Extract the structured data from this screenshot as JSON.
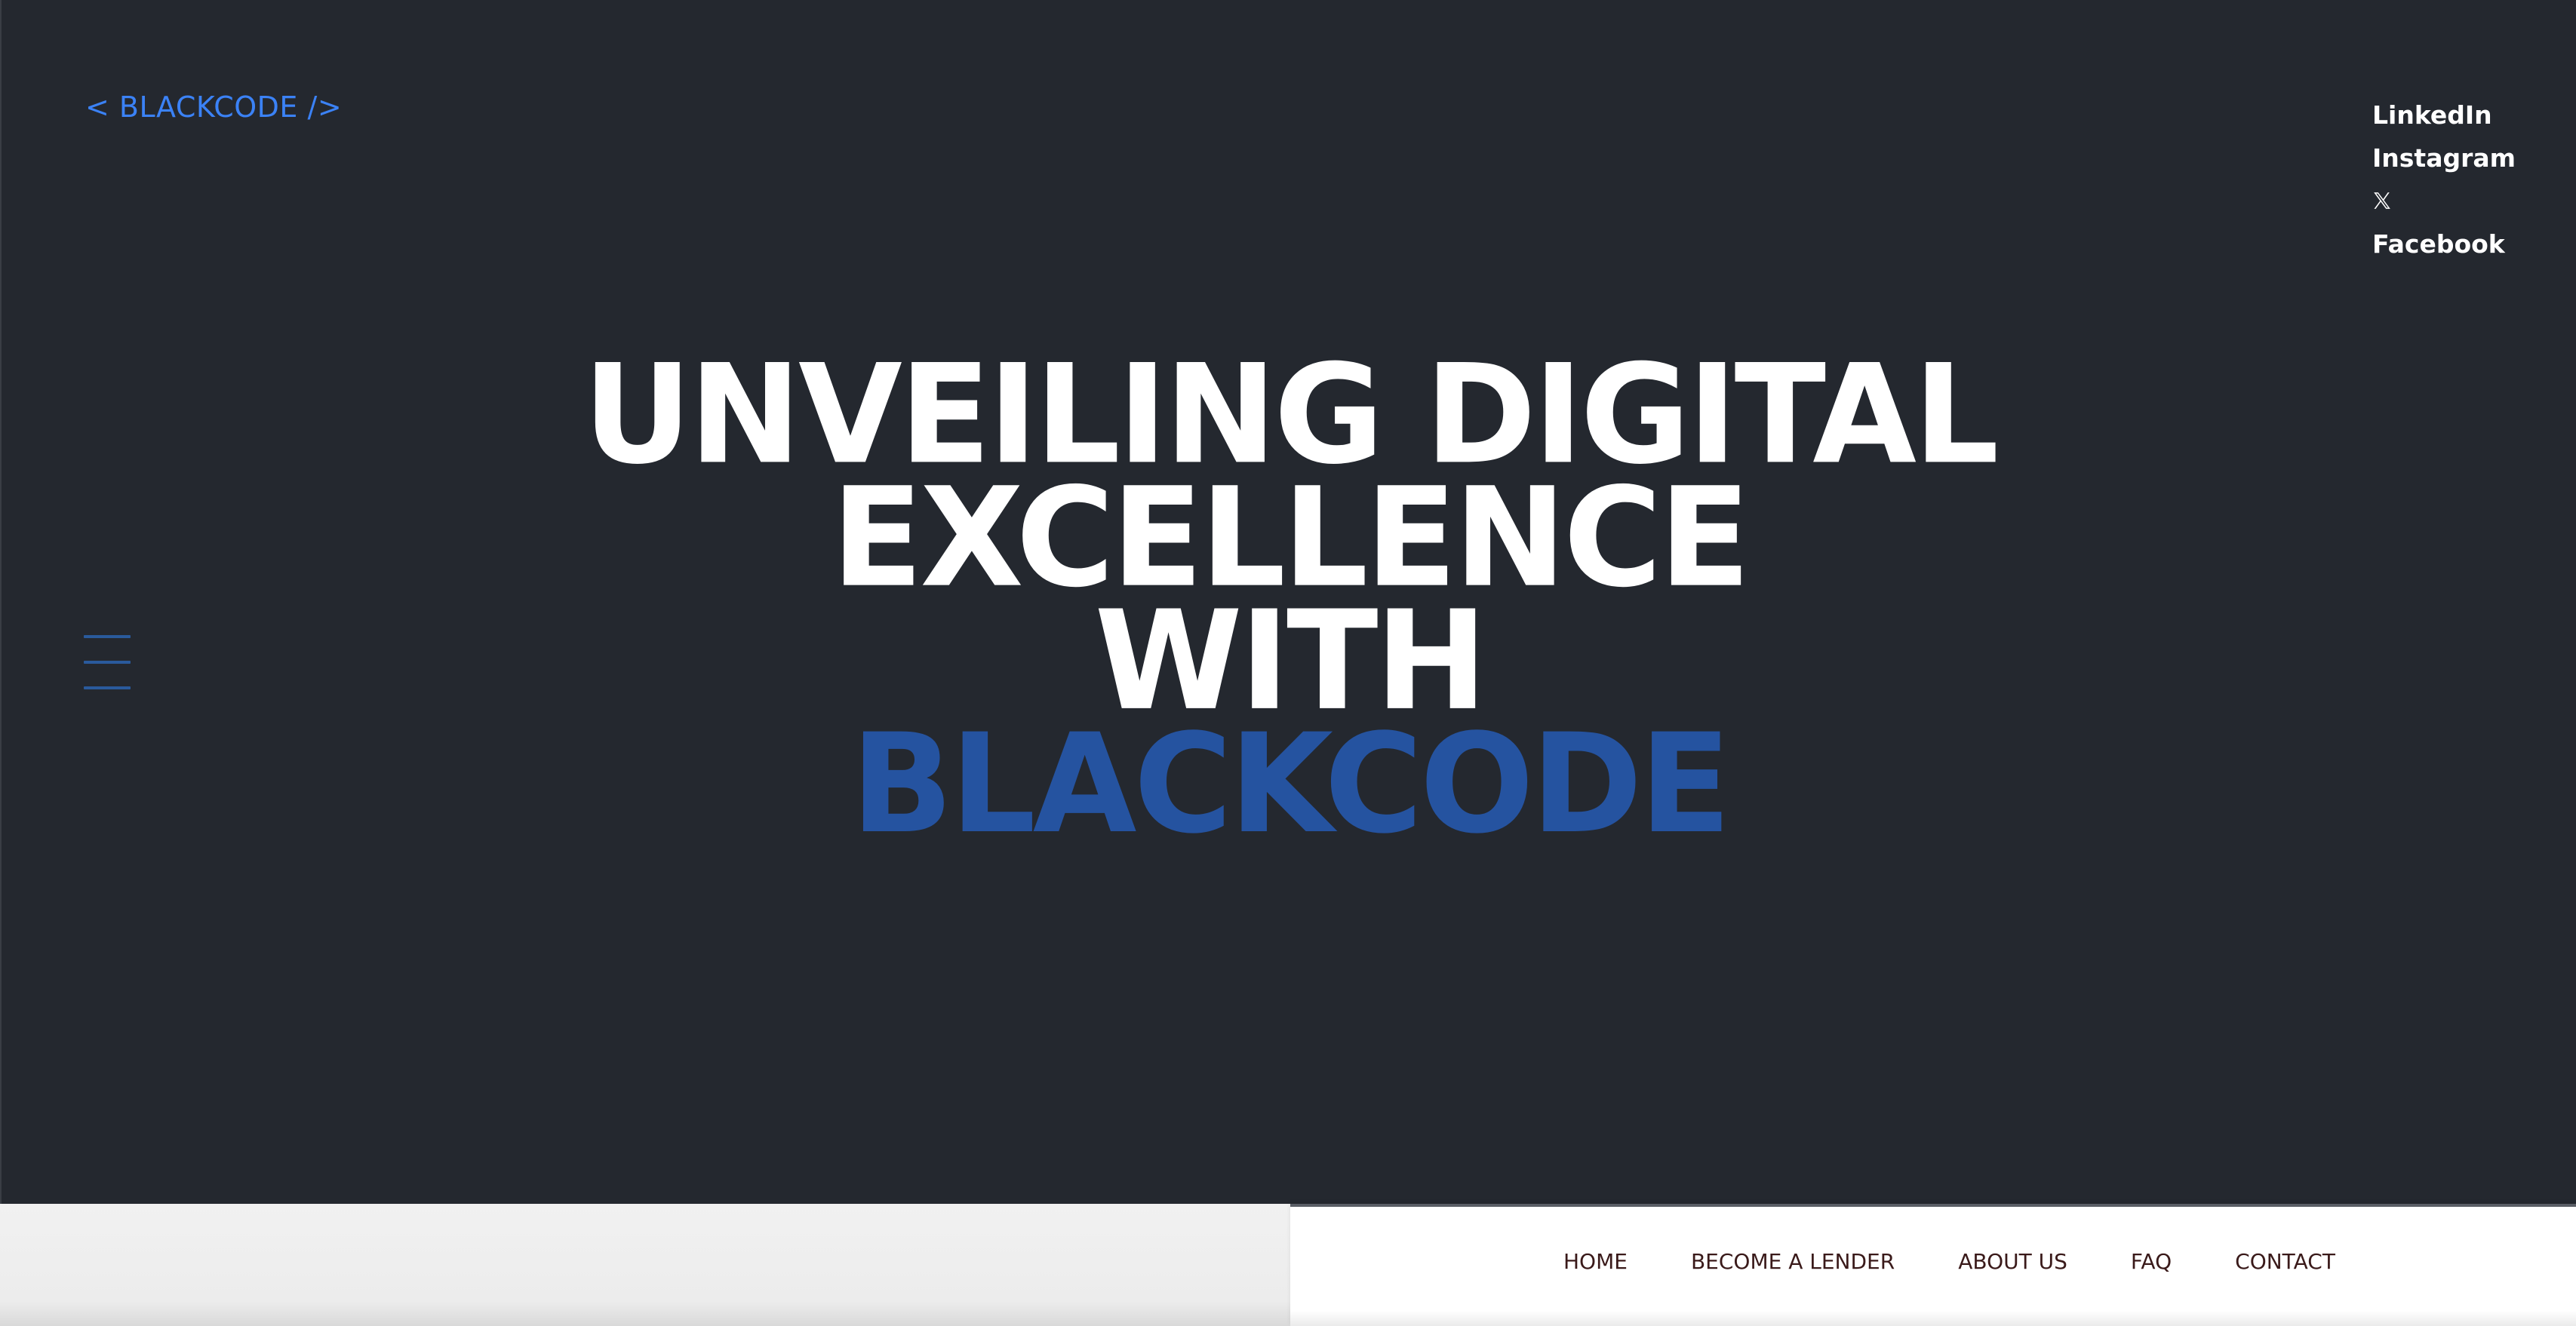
{
  "brand": {
    "logo_text": "< BLACKCODE />",
    "accent_color": "#3b82f6",
    "highlight_color": "#2553a0",
    "background_color": "#24282f"
  },
  "social": {
    "linkedin": "LinkedIn",
    "instagram": "Instagram",
    "x_icon": "x-logo-icon",
    "facebook": "Facebook"
  },
  "menu": {
    "icon": "hamburger-menu-icon"
  },
  "hero": {
    "line1": "UNVEILING DIGITAL",
    "line2": "EXCELLENCE",
    "line3": "WITH",
    "line4": "BLACKCODE"
  },
  "nav": {
    "items": [
      "HOME",
      "BECOME A LENDER",
      "ABOUT US",
      "FAQ",
      "CONTACT"
    ]
  }
}
